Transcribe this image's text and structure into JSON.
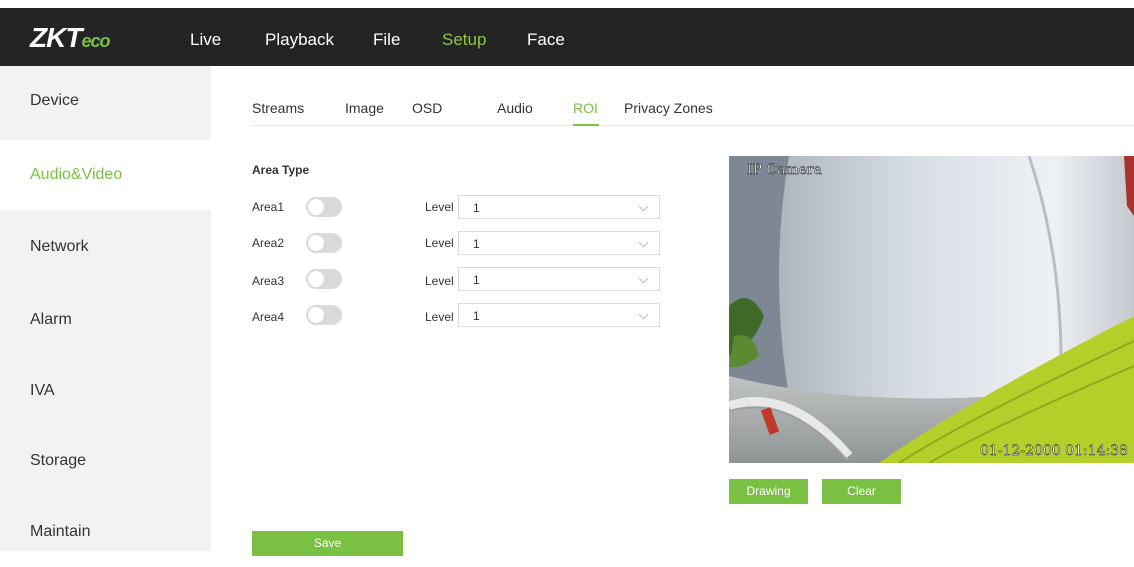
{
  "brand": {
    "logo_main": "ZKT",
    "logo_accent": "eco"
  },
  "nav": {
    "items": [
      {
        "label": "Live"
      },
      {
        "label": "Playback"
      },
      {
        "label": "File"
      },
      {
        "label": "Setup"
      },
      {
        "label": "Face"
      }
    ],
    "active": "Setup"
  },
  "sidebar": {
    "items": [
      {
        "label": "Device"
      },
      {
        "label": "Audio&Video"
      },
      {
        "label": "Network"
      },
      {
        "label": "Alarm"
      },
      {
        "label": "IVA"
      },
      {
        "label": "Storage"
      },
      {
        "label": "Maintain"
      }
    ],
    "active": "Audio&Video"
  },
  "tabs": {
    "items": [
      {
        "label": "Streams"
      },
      {
        "label": "Image"
      },
      {
        "label": "OSD"
      },
      {
        "label": "Audio"
      },
      {
        "label": "ROI"
      },
      {
        "label": "Privacy Zones"
      }
    ],
    "active": "ROI"
  },
  "roi": {
    "title": "Area Type",
    "areas": [
      {
        "label": "Area1",
        "enabled": false,
        "level_label": "Level",
        "level": "1"
      },
      {
        "label": "Area2",
        "enabled": false,
        "level_label": "Level",
        "level": "1"
      },
      {
        "label": "Area3",
        "enabled": false,
        "level_label": "Level",
        "level": "1"
      },
      {
        "label": "Area4",
        "enabled": false,
        "level_label": "Level",
        "level": "1"
      }
    ]
  },
  "video": {
    "overlay_title": "IP Camera",
    "overlay_time": "01-12-2000 01:14:38"
  },
  "buttons": {
    "drawing": "Drawing",
    "clear": "Clear",
    "save": "Save"
  },
  "colors": {
    "accent": "#7ac143",
    "topbar": "#242424",
    "sidebar": "#f2f2f2",
    "toggle_off": "#d9d9d9"
  }
}
